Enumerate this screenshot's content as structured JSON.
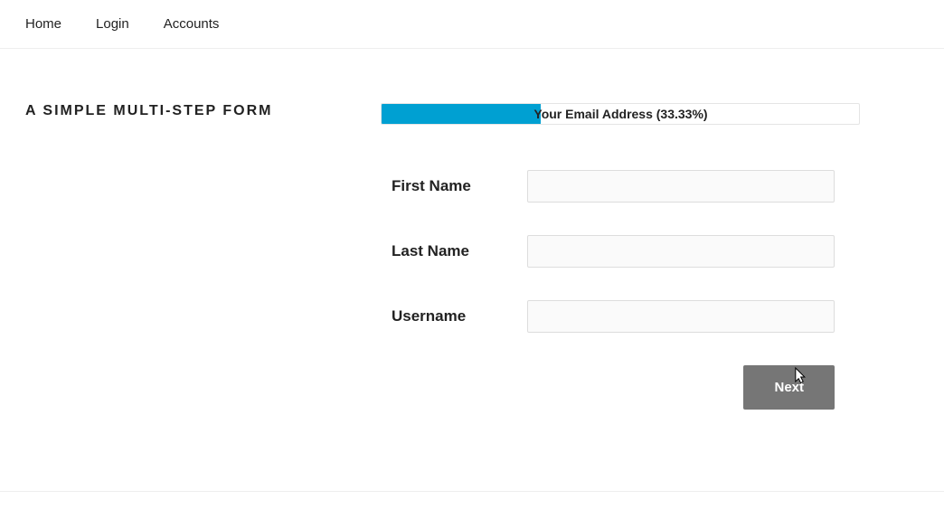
{
  "nav": {
    "home": "Home",
    "login": "Login",
    "accounts": "Accounts"
  },
  "title": "A SIMPLE MULTI-STEP FORM",
  "progress": {
    "percent": 33.33,
    "label": "Your Email Address (33.33%)"
  },
  "form": {
    "first_name_label": "First Name",
    "first_name_value": "",
    "last_name_label": "Last Name",
    "last_name_value": "",
    "username_label": "Username",
    "username_value": ""
  },
  "actions": {
    "next_label": "Next"
  }
}
